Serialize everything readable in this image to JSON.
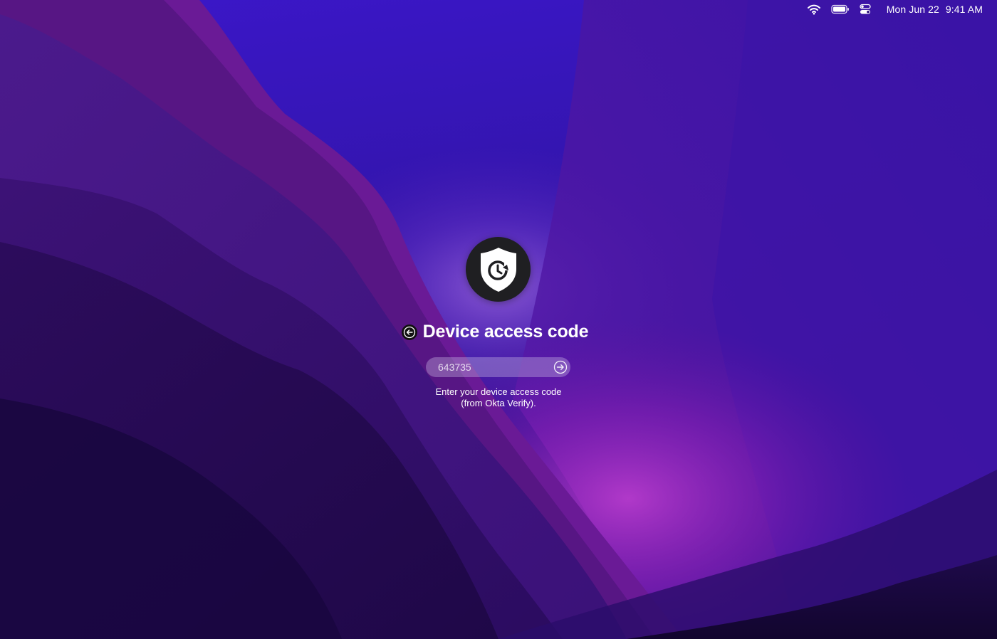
{
  "menubar": {
    "wifi_icon": "wifi-icon",
    "battery_icon": "battery-icon",
    "control_center_icon": "control-center-icon",
    "date": "Mon Jun 22",
    "time": "9:41 AM"
  },
  "login": {
    "avatar_icon": "shield-clock-icon",
    "back_icon": "arrow-left-circle-icon",
    "title": "Device access code",
    "code_value": "643735",
    "submit_icon": "arrow-right-circle-icon",
    "hint_line1": "Enter your device access code",
    "hint_line2": "(from Okta Verify)."
  },
  "colors": {
    "title_text": "#ffffff",
    "avatar_bg": "#1f1f22",
    "field_bg": "rgba(200,185,230,0.38)"
  }
}
